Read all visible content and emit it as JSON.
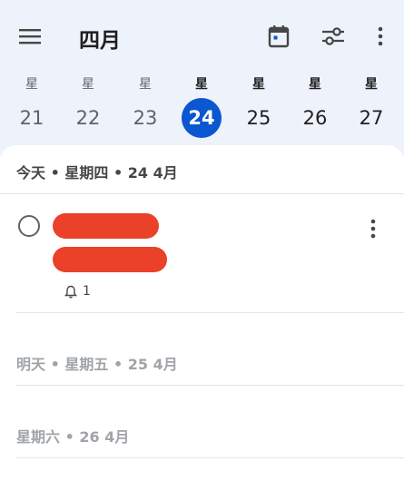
{
  "header": {
    "title": "四月",
    "icons": [
      "menu-icon",
      "calendar-today-icon",
      "tune-icon",
      "more-vert-icon"
    ],
    "background": "#eef2fb"
  },
  "week": {
    "days": [
      {
        "label": "星",
        "date": "21",
        "state": "past"
      },
      {
        "label": "星",
        "date": "22",
        "state": "past"
      },
      {
        "label": "星",
        "date": "23",
        "state": "past"
      },
      {
        "label": "星",
        "date": "24",
        "state": "today"
      },
      {
        "label": "星",
        "date": "25",
        "state": "future"
      },
      {
        "label": "星",
        "date": "26",
        "state": "future"
      },
      {
        "label": "星",
        "date": "27",
        "state": "future"
      }
    ],
    "today_color": "#0b57d0"
  },
  "sections": {
    "today": "今天 • 星期四 • 24 4月",
    "tomorrow": "明天 • 星期五 • 25 4月",
    "saturday": "星期六 • 26 4月"
  },
  "task": {
    "reminder_count": "1",
    "redaction_color": "#ea4128"
  }
}
